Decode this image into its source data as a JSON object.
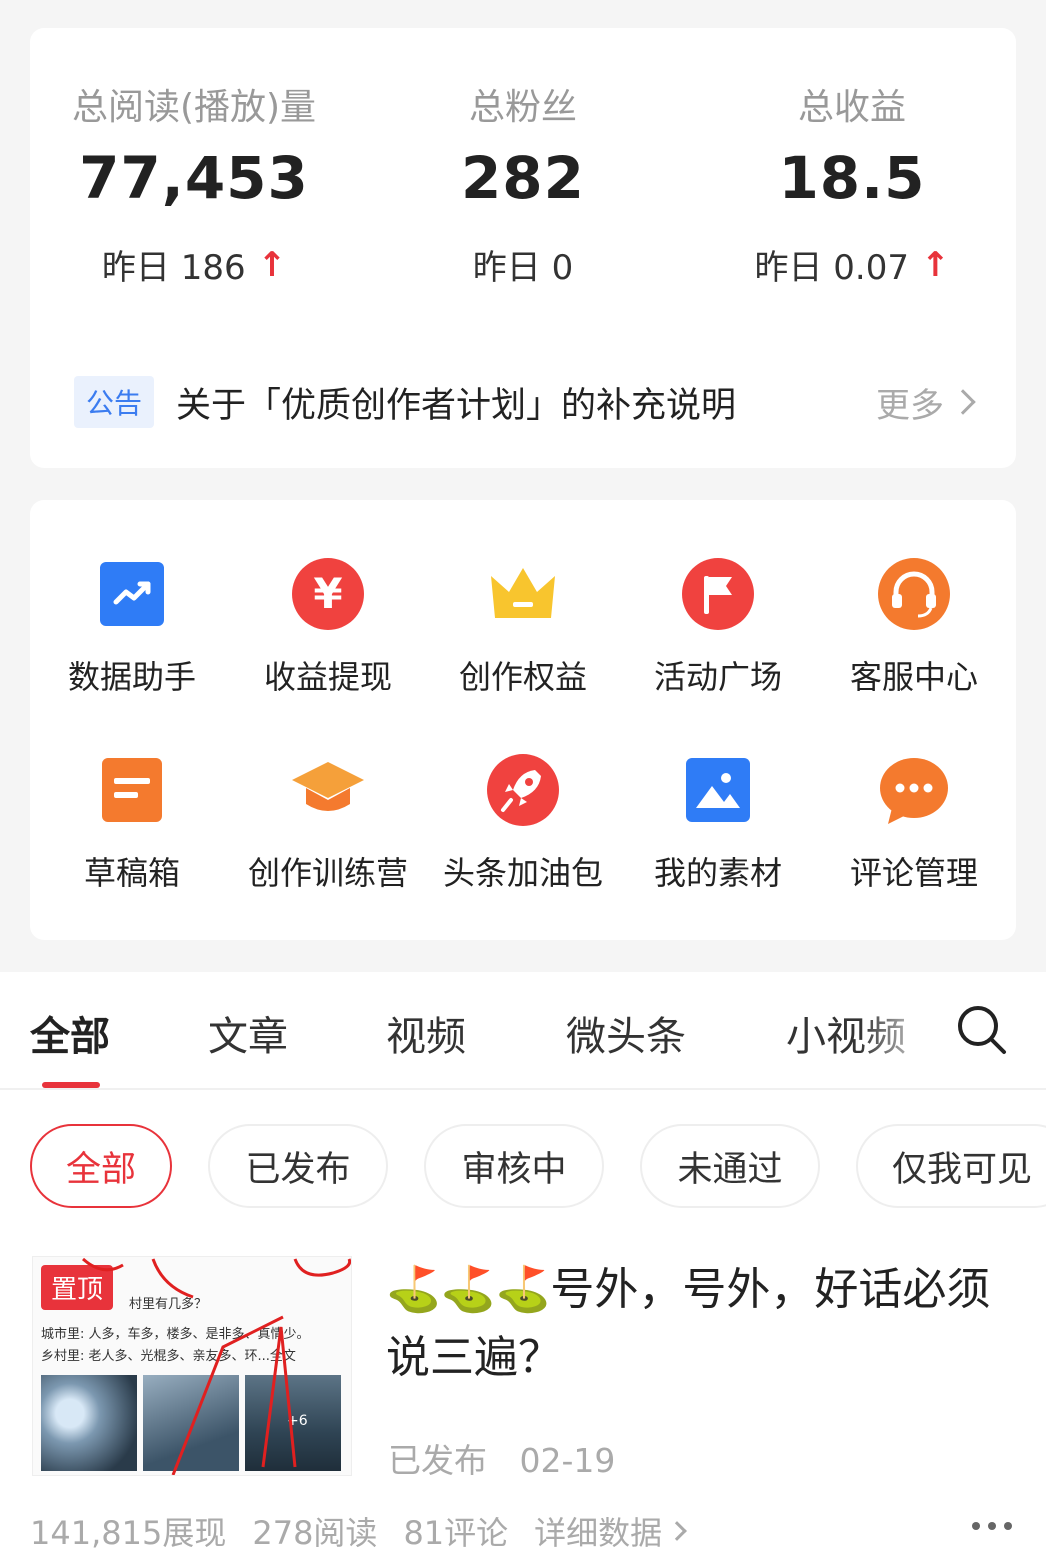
{
  "stats": {
    "reads": {
      "label": "总阅读(播放)量",
      "value": "77,453",
      "yesterday": "昨日 186",
      "trend": "up"
    },
    "fans": {
      "label": "总粉丝",
      "value": "282",
      "yesterday": "昨日 0"
    },
    "income": {
      "label": "总收益",
      "value": "18.5",
      "yesterday": "昨日 0.07",
      "trend": "up"
    }
  },
  "notice": {
    "tag": "公告",
    "text": "关于「优质创作者计划」的补充说明",
    "more": "更多"
  },
  "tools": [
    {
      "label": "数据助手",
      "icon": "data-chart-icon"
    },
    {
      "label": "收益提现",
      "icon": "yuan-icon"
    },
    {
      "label": "创作权益",
      "icon": "crown-icon"
    },
    {
      "label": "活动广场",
      "icon": "flag-icon"
    },
    {
      "label": "客服中心",
      "icon": "headset-icon"
    },
    {
      "label": "草稿箱",
      "icon": "draft-icon"
    },
    {
      "label": "创作训练营",
      "icon": "graduation-cap-icon"
    },
    {
      "label": "头条加油包",
      "icon": "rocket-icon"
    },
    {
      "label": "我的素材",
      "icon": "image-icon"
    },
    {
      "label": "评论管理",
      "icon": "chat-icon"
    }
  ],
  "tabs": [
    "全部",
    "文章",
    "视频",
    "微头条",
    "小视频"
  ],
  "filters": [
    "全部",
    "已发布",
    "审核中",
    "未通过",
    "仅我可见"
  ],
  "article": {
    "pin": "置顶",
    "thumb_title": "村里有几多？",
    "thumb_line1": "城市里: 人多，车多，楼多、是非多、真情少。",
    "thumb_line2": "乡村里: 老人多、光棍多、亲友多、环...全文",
    "thumb_more": "+6",
    "title": "⛳⛳⛳号外，号外，好话必须说三遍？",
    "status": "已发布",
    "date": "02-19",
    "impressions": "141,815展现",
    "reads": "278阅读",
    "comments": "81评论",
    "detail": "详细数据"
  },
  "colors": {
    "accent": "#e8333b",
    "blue": "#3b7cf0"
  }
}
